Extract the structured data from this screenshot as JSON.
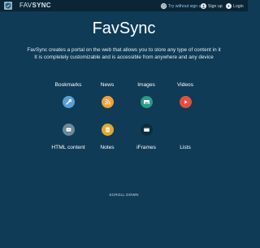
{
  "header": {
    "brand_fav": "FAV",
    "brand_sync": "SYNC",
    "nav": {
      "try": "Try without sign up",
      "signup": "Sign up",
      "login": "Login"
    }
  },
  "hero": {
    "title": "FavSync",
    "description_line1": "FavSync creates a portal on the web that allows you to store any type of content in it",
    "description_line2": "It is completely customizable and is accessible from anywhere and any device"
  },
  "features": {
    "bookmarks": {
      "label": "Bookmarks",
      "icon": "wrench-icon",
      "color": "#5aa0d6"
    },
    "news": {
      "label": "News",
      "icon": "rss-icon",
      "color": "#f0a13a"
    },
    "images": {
      "label": "Images",
      "icon": "image-icon",
      "color": "#2c9a8a"
    },
    "videos": {
      "label": "Videos",
      "icon": "play-icon",
      "color": "#e2503d"
    },
    "html_content": {
      "label": "HTML content",
      "icon": "html-icon",
      "color": "#6c8a9c"
    },
    "notes": {
      "label": "Notes",
      "icon": "note-icon",
      "color": "#e3a92e"
    },
    "iframes": {
      "label": "iFrames",
      "icon": "iframe-icon",
      "color": "#0d2d40"
    },
    "lists": {
      "label": "Lists",
      "icon": "list-icon",
      "color": "#0f3b57"
    }
  },
  "footer": {
    "scroll_label": "SCROLL DOWN"
  },
  "colors": {
    "background": "#0f3b57",
    "topbar": "#0a2536",
    "link_blue": "#8ec9ef"
  }
}
